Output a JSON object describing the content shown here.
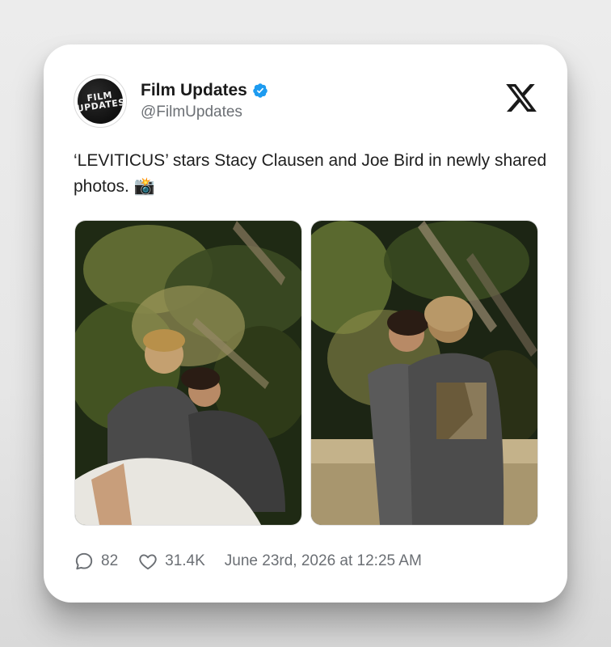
{
  "account": {
    "name": "Film Updates",
    "handle": "@FilmUpdates",
    "avatar_text": [
      "FILM",
      "UPDATES"
    ],
    "verified_icon": "verified-badge-icon",
    "verified_color": "#1d9bf0"
  },
  "platform_logo": "x-logo-icon",
  "tweet": {
    "text": "‘LEVITICUS’ stars Stacy Clausen and Joe Bird in newly shared photos. 📸"
  },
  "photos": [
    {
      "alt": "Two young men sitting under tropical foliage at night, one leaning his head on the other's shoulder"
    },
    {
      "alt": "Two young men standing by a ledge in front of tropical foliage at night, one looking back over his shoulder"
    }
  ],
  "footer": {
    "replies_icon": "reply-bubble-icon",
    "replies": "82",
    "likes_icon": "heart-icon",
    "likes": "31.4K",
    "timestamp": "June 23rd, 2026 at 12:25 AM"
  },
  "colors": {
    "card_bg": "#ffffff",
    "text": "#1f1f1f",
    "muted": "#6b6f74"
  }
}
